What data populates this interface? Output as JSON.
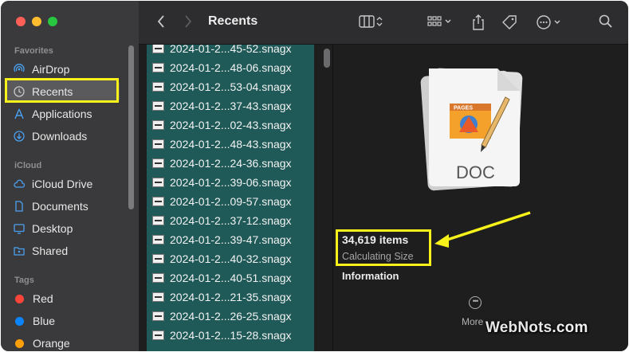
{
  "window": {
    "title": "Recents"
  },
  "sidebar": {
    "sections": {
      "favorites": "Favorites",
      "icloud": "iCloud",
      "tags": "Tags"
    },
    "favorites": [
      {
        "label": "AirDrop",
        "icon": "airdrop-icon"
      },
      {
        "label": "Recents",
        "icon": "clock-icon",
        "selected": true
      },
      {
        "label": "Applications",
        "icon": "applications-icon"
      },
      {
        "label": "Downloads",
        "icon": "download-icon"
      }
    ],
    "icloud": [
      {
        "label": "iCloud Drive",
        "icon": "cloud-icon"
      },
      {
        "label": "Documents",
        "icon": "document-icon"
      },
      {
        "label": "Desktop",
        "icon": "desktop-icon"
      },
      {
        "label": "Shared",
        "icon": "shared-folder-icon"
      }
    ],
    "tags": [
      {
        "label": "Red",
        "color": "#ff453a"
      },
      {
        "label": "Blue",
        "color": "#0a84ff"
      },
      {
        "label": "Orange",
        "color": "#ff9f0a"
      }
    ]
  },
  "toolbar": {
    "back_icon": "chevron-left-icon",
    "forward_icon": "chevron-right-icon",
    "view_icon": "column-view-icon",
    "group_icon": "grid-group-icon",
    "share_icon": "share-icon",
    "tag_icon": "tag-icon",
    "more_icon": "ellipsis-circle-icon",
    "search_icon": "search-icon"
  },
  "files": [
    "2024-01-2...45-52.snagx",
    "2024-01-2...48-06.snagx",
    "2024-01-2...53-04.snagx",
    "2024-01-2...37-43.snagx",
    "2024-01-2...02-43.snagx",
    "2024-01-2...48-43.snagx",
    "2024-01-2...24-36.snagx",
    "2024-01-2...39-06.snagx",
    "2024-01-2...09-57.snagx",
    "2024-01-2...37-12.snagx",
    "2024-01-2...39-47.snagx",
    "2024-01-2...40-32.snagx",
    "2024-01-2...40-51.snagx",
    "2024-01-2...21-35.snagx",
    "2024-01-2...26-25.snagx",
    "2024-01-2...15-28.snagx"
  ],
  "preview": {
    "doc_label": "DOC",
    "pages_label": "PAGES",
    "item_count": "34,619 items",
    "size_status": "Calculating Size",
    "info_heading": "Information",
    "more_label": "More"
  },
  "watermark": {
    "name": "WebNots",
    "suffix": ".com"
  },
  "colors": {
    "highlight": "#f7f21a",
    "file_list_bg": "#1f5a58",
    "sidebar_bg": "#3a3a3c"
  }
}
